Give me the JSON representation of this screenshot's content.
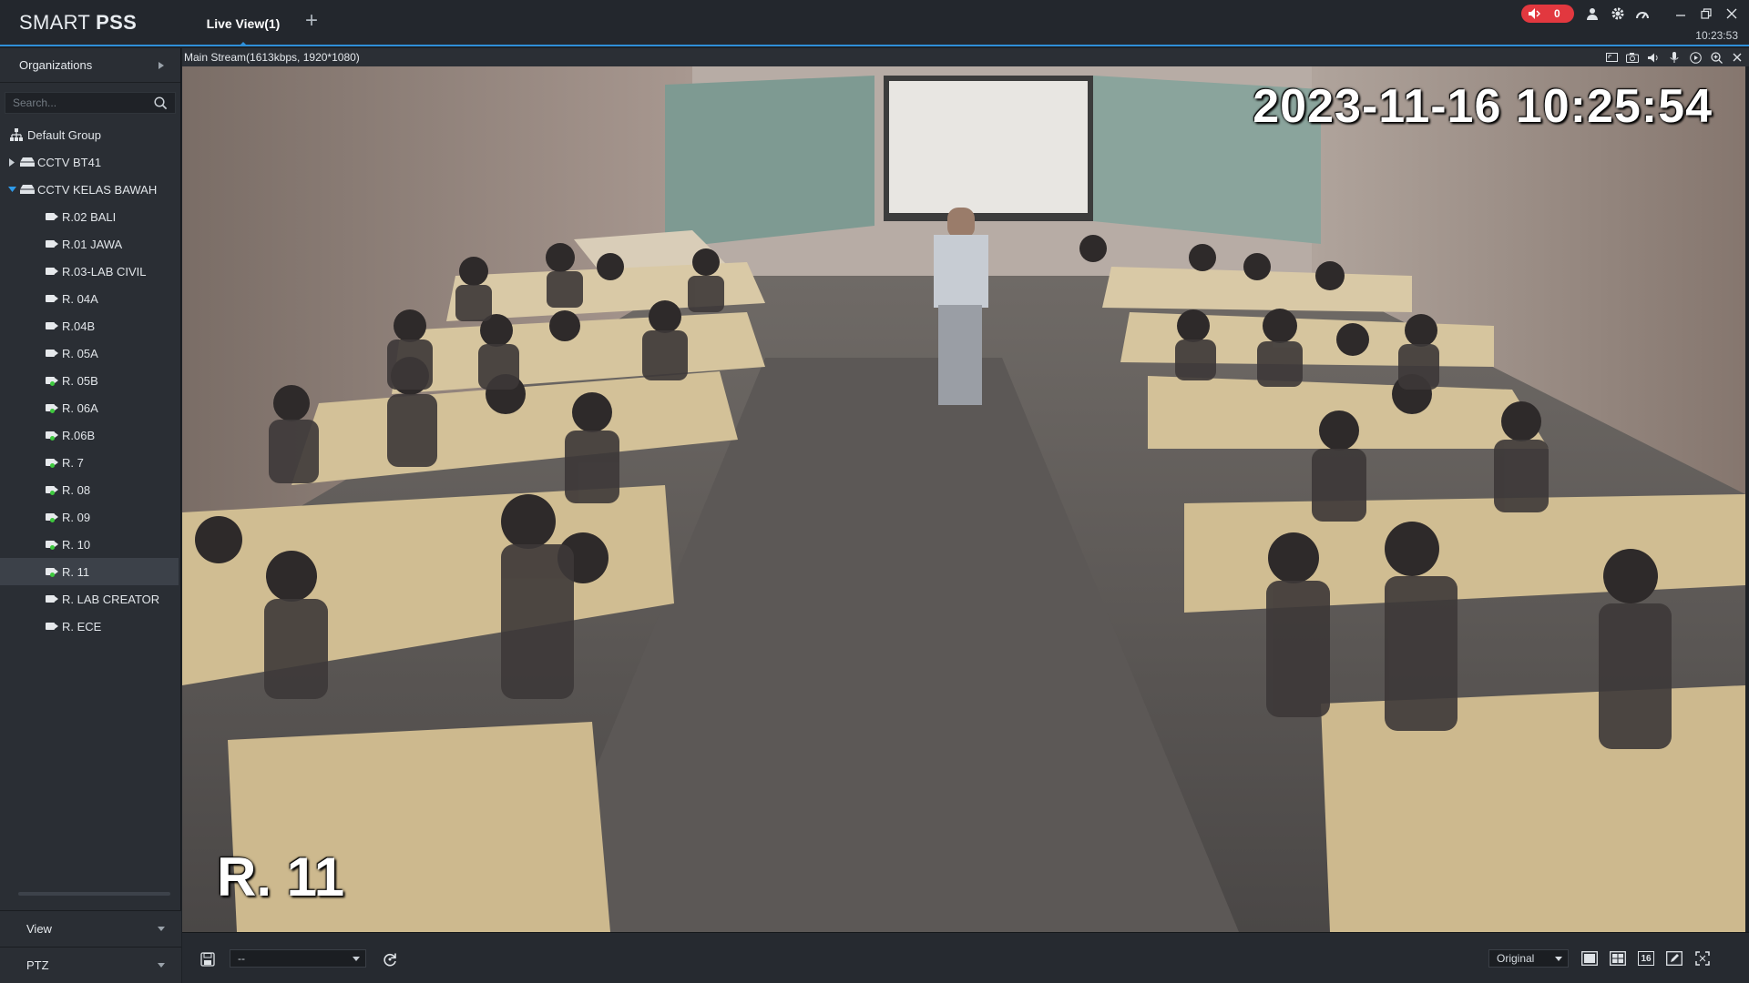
{
  "app": {
    "brand_light": "SMART ",
    "brand_bold": "PSS"
  },
  "tabs": [
    {
      "label": "Live View(1)"
    }
  ],
  "titlebar": {
    "alarm_count": "0",
    "clock": "10:23:53",
    "accent_color": "#2f8fd8",
    "alarm_color": "#e2383f"
  },
  "sidebar": {
    "organizations_label": "Organizations",
    "search_placeholder": "Search...",
    "tree": {
      "root": "Default Group",
      "groups": [
        {
          "label": "CCTV BT41",
          "expanded": false
        },
        {
          "label": "CCTV KELAS BAWAH",
          "expanded": true
        }
      ],
      "cameras": [
        {
          "label": "R.02 BALI",
          "online": false
        },
        {
          "label": "R.01 JAWA",
          "online": false
        },
        {
          "label": "R.03-LAB CIVIL",
          "online": false
        },
        {
          "label": "R. 04A",
          "online": false
        },
        {
          "label": "R.04B",
          "online": false
        },
        {
          "label": "R. 05A",
          "online": false
        },
        {
          "label": "R. 05B",
          "online": true
        },
        {
          "label": "R. 06A",
          "online": true
        },
        {
          "label": "R.06B",
          "online": true
        },
        {
          "label": "R. 7",
          "online": true
        },
        {
          "label": "R. 08",
          "online": true
        },
        {
          "label": "R. 09",
          "online": true
        },
        {
          "label": "R. 10",
          "online": true
        },
        {
          "label": "R. 11",
          "online": true,
          "selected": true
        },
        {
          "label": "R. LAB CREATOR",
          "online": false
        },
        {
          "label": "R. ECE",
          "online": false
        }
      ]
    },
    "view_label": "View",
    "ptz_label": "PTZ"
  },
  "stream": {
    "info": "Main Stream(1613kbps, 1920*1080)",
    "osd_timestamp": "2023-11-16 10:25:54",
    "osd_channel": "R. 11"
  },
  "bottombar": {
    "view_select": "--",
    "ratio_select": "Original",
    "grid_16_label": "16"
  }
}
